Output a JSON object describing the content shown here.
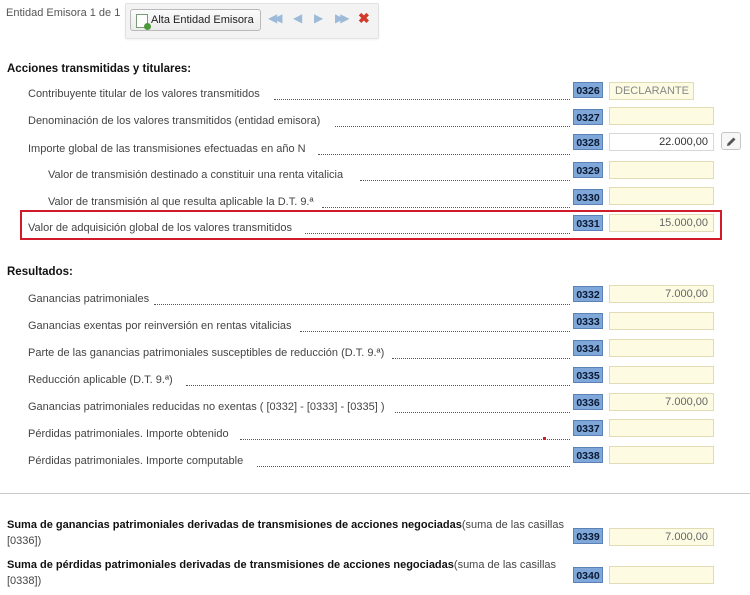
{
  "toolbar": {
    "entity_label": "Entidad Emisora 1 de 1",
    "alta_label": "Alta Entidad Emisora",
    "nav_first": "◀◀",
    "nav_prev": "◀",
    "nav_next": "▶",
    "nav_last": "▶▶",
    "close": "✖"
  },
  "acciones": {
    "title": "Acciones transmitidas y titulares:",
    "rows": [
      {
        "label": "Contribuyente titular de los valores transmitidos",
        "code": "0326",
        "value": "DECLARANTE"
      },
      {
        "label": "Denominación de los valores transmitidos (entidad emisora)",
        "code": "0327",
        "value": ""
      },
      {
        "label": "Importe global de las transmisiones efectuadas en año N",
        "code": "0328",
        "value": "22.000,00"
      },
      {
        "label": "Valor de transmisión destinado a constituir una renta vitalicia",
        "code": "0329",
        "value": ""
      },
      {
        "label": "Valor de transmisión al que resulta aplicable la D.T. 9.ª",
        "code": "0330",
        "value": ""
      },
      {
        "label": "Valor de adquisición global de los valores transmitidos",
        "code": "0331",
        "value": "15.000,00"
      }
    ]
  },
  "resultados": {
    "title": "Resultados:",
    "rows": [
      {
        "label": "Ganancias patrimoniales",
        "code": "0332",
        "value": "7.000,00"
      },
      {
        "label": "Ganancias exentas por reinversión en rentas vitalicias",
        "code": "0333",
        "value": ""
      },
      {
        "label": "Parte de las ganancias patrimoniales susceptibles de reducción (D.T. 9.ª)",
        "code": "0334",
        "value": ""
      },
      {
        "label": "Reducción aplicable (D.T. 9.ª)",
        "code": "0335",
        "value": ""
      },
      {
        "label": "Ganancias patrimoniales reducidas no exentas ( [0332] - [0333] - [0335] )",
        "code": "0336",
        "value": "7.000,00"
      },
      {
        "label": "Pérdidas patrimoniales. Importe obtenido",
        "code": "0337",
        "value": ""
      },
      {
        "label": "Pérdidas patrimoniales. Importe computable",
        "code": "0338",
        "value": ""
      }
    ]
  },
  "sumas": [
    {
      "bold": "Suma de ganancias patrimoniales derivadas de transmisiones de acciones negociadas",
      "muted": "(suma de las casillas [0336])",
      "code": "0339",
      "value": "7.000,00"
    },
    {
      "bold": "Suma de pérdidas patrimoniales derivadas de transmisiones de acciones negociadas",
      "muted": "(suma de las casillas [0338])",
      "code": "0340",
      "value": ""
    }
  ],
  "colors": {
    "code_bg": "#7fa7d9",
    "field_bg": "#fdfbe2",
    "highlight": "#d11a2a"
  }
}
